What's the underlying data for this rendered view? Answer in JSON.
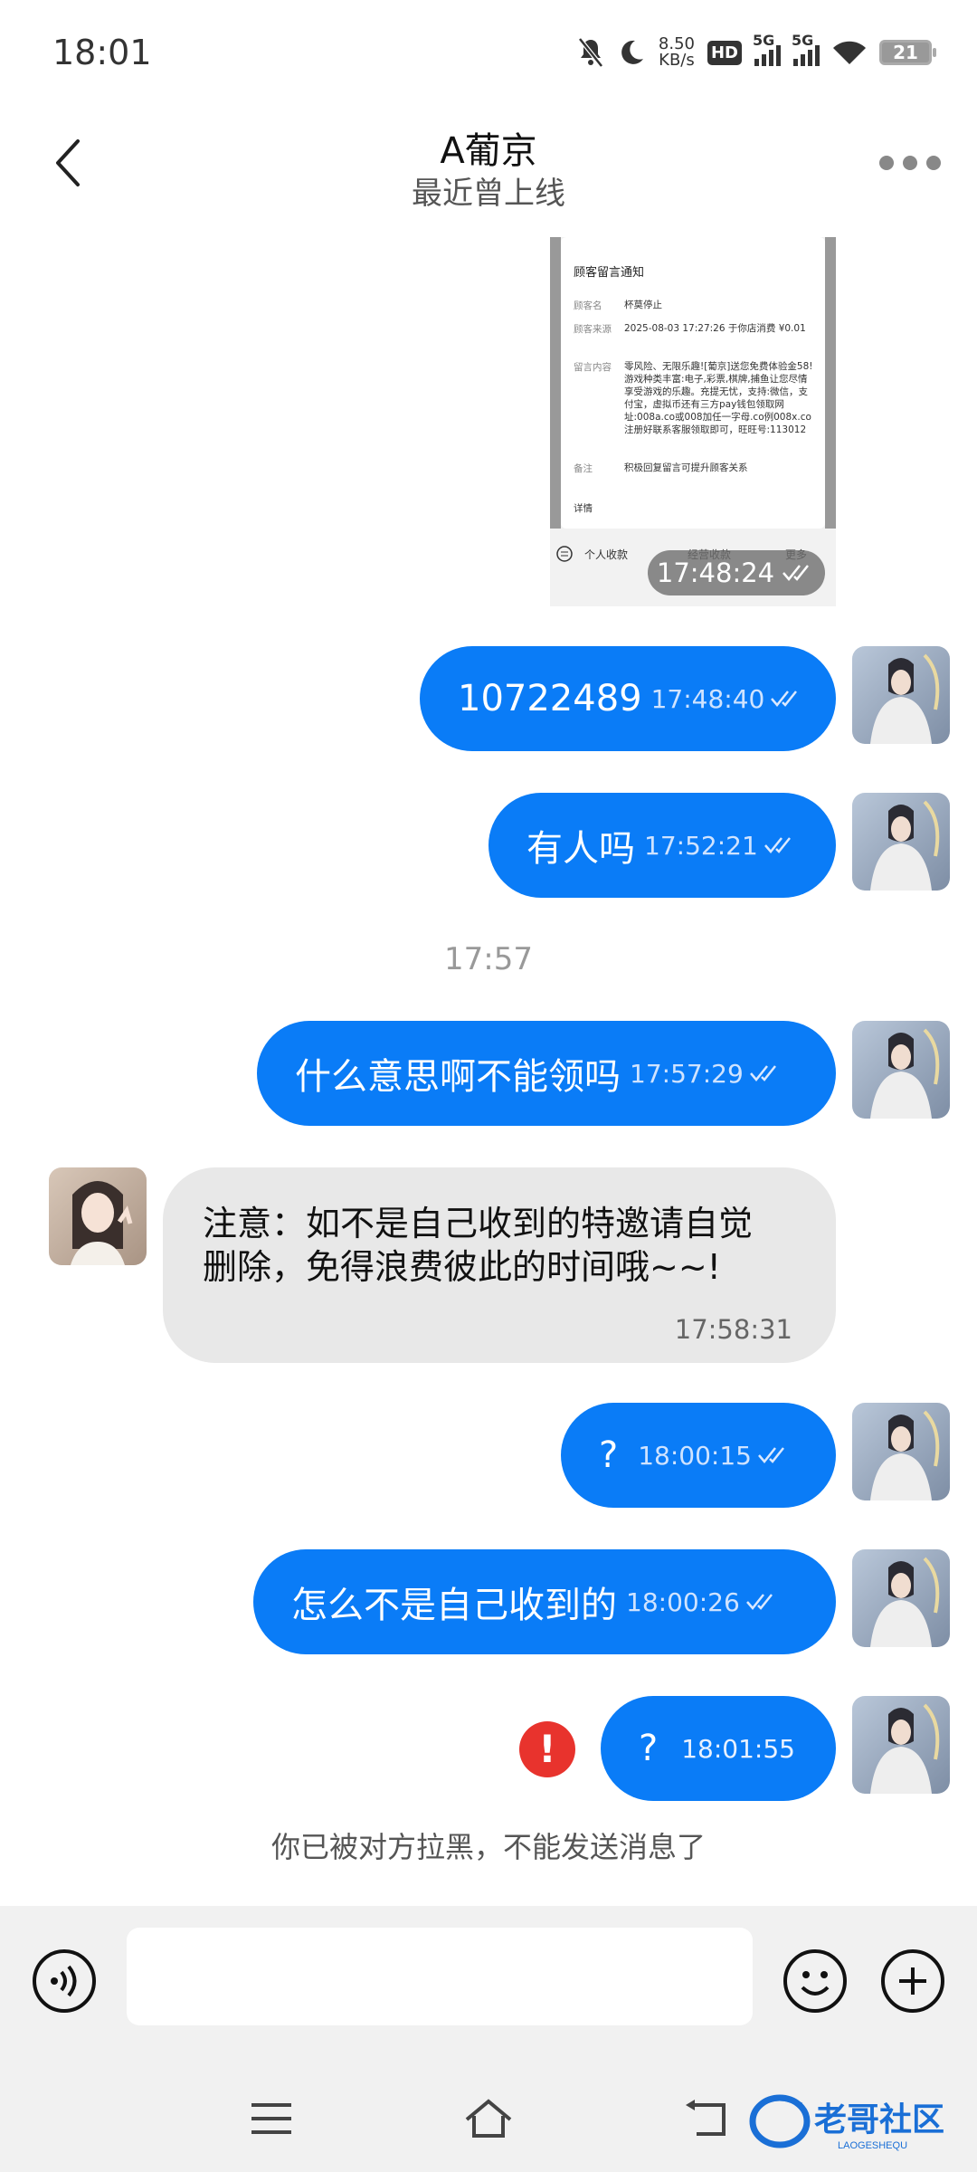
{
  "status_bar": {
    "time": "18:01",
    "net_speed_value": "8.50",
    "net_speed_unit": "KB/s",
    "hd_label": "HD",
    "sim1_label": "5G",
    "sim2_label": "5G",
    "battery": "21"
  },
  "header": {
    "title": "A葡京",
    "subtitle": "最近曾上线"
  },
  "shared_image": {
    "heading": "顾客留言通知",
    "rows": [
      {
        "label": "顾客名",
        "value": "杯莫停止"
      },
      {
        "label": "顾客来源",
        "value": "2025-08-03 17:27:26 于你店消费 ¥0.01"
      },
      {
        "label": "留言内容",
        "value": "零风险、无限乐趣![葡京]送您免费体验金58!游戏种类丰富:电子,彩票,棋牌,捕鱼让您尽情享受游戏的乐趣。充提无忧，支持:微信，支付宝，虚拟币还有三方pay钱包领取网址:008a.co或008加任一字母.co例008x.co注册好联系客服领取即可，旺旺号:113012"
      },
      {
        "label": "备注",
        "value": "积极回复留言可提升顾客关系"
      }
    ],
    "detail_label": "详情",
    "tabs": [
      "个人收款",
      "经营收款",
      "更多"
    ],
    "timestamp": "17:48:24"
  },
  "messages": {
    "m1": {
      "text": "10722489",
      "time": "17:48:40"
    },
    "m2": {
      "text": "有人吗",
      "time": "17:52:21"
    },
    "separator": "17:57",
    "m3": {
      "text": "什么意思啊不能领吗",
      "time": "17:57:29"
    },
    "in1": {
      "text": "注意：如不是自己收到的特邀请自觉删除，免得浪费彼此的时间哦~~!",
      "time": "17:58:31"
    },
    "m4": {
      "text": "?",
      "time": "18:00:15"
    },
    "m5": {
      "text": "怎么不是自己收到的",
      "time": "18:00:26"
    },
    "m6": {
      "text": "?",
      "time": "18:01:55"
    },
    "error_mark": "!",
    "blocked_notice": "你已被对方拉黑，不能发送消息了"
  },
  "watermark": {
    "text": "老哥社区",
    "sub": "LAOGESHEQU"
  },
  "colors": {
    "accent": "#0a7cf7",
    "error": "#e8332d",
    "incoming": "#e8e8e8"
  }
}
